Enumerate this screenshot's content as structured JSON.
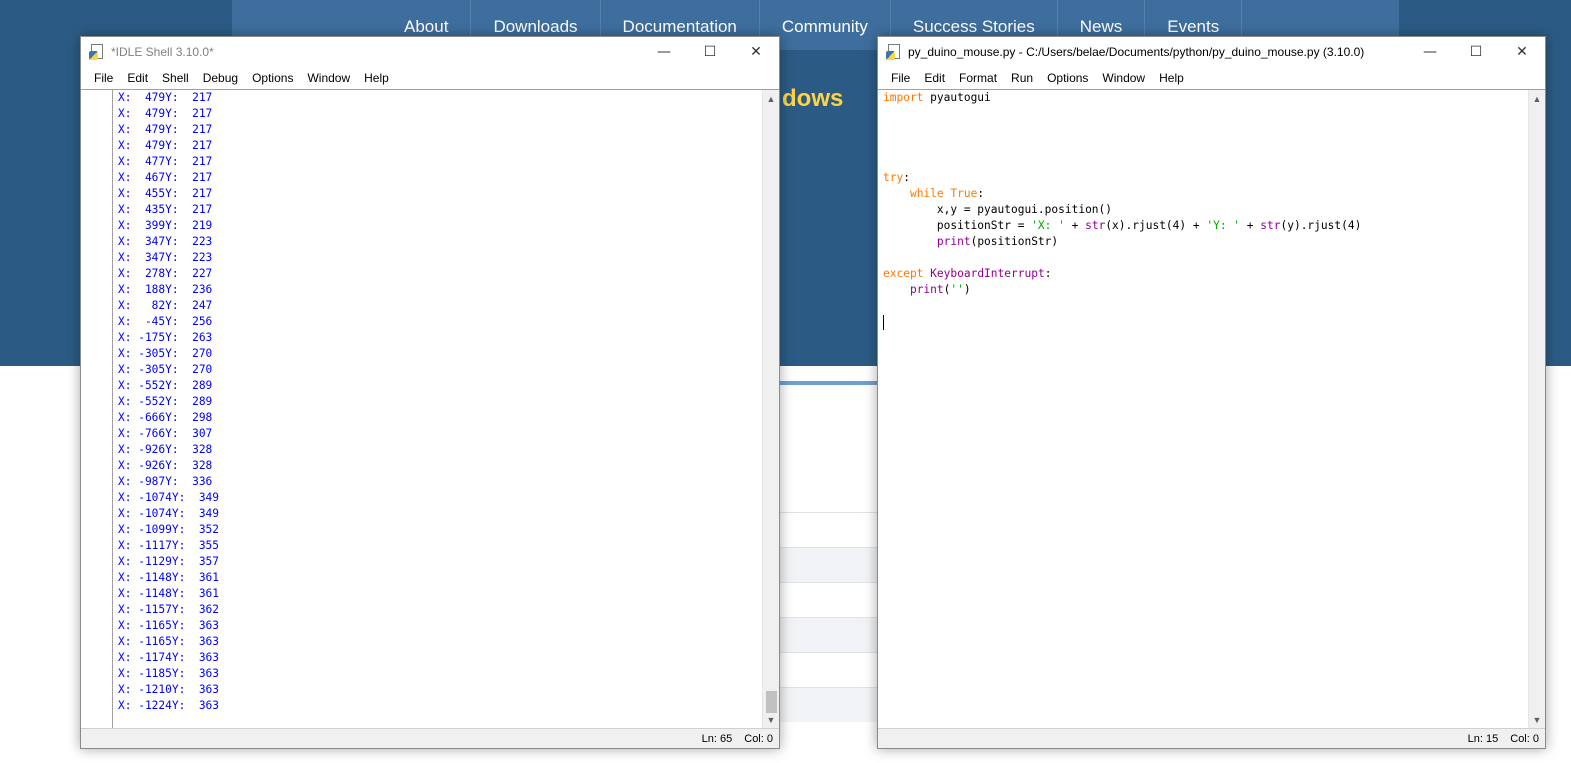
{
  "website": {
    "nav": [
      "About",
      "Downloads",
      "Documentation",
      "Community",
      "Success Stories",
      "News",
      "Events"
    ],
    "heading_fragment": "dows"
  },
  "shell_window": {
    "title": "*IDLE Shell 3.10.0*",
    "menu": [
      "File",
      "Edit",
      "Shell",
      "Debug",
      "Options",
      "Window",
      "Help"
    ],
    "output_lines": [
      "X:  479Y:  217",
      "X:  479Y:  217",
      "X:  479Y:  217",
      "X:  479Y:  217",
      "X:  477Y:  217",
      "X:  467Y:  217",
      "X:  455Y:  217",
      "X:  435Y:  217",
      "X:  399Y:  219",
      "X:  347Y:  223",
      "X:  347Y:  223",
      "X:  278Y:  227",
      "X:  188Y:  236",
      "X:   82Y:  247",
      "X:  -45Y:  256",
      "X: -175Y:  263",
      "X: -305Y:  270",
      "X: -305Y:  270",
      "X: -552Y:  289",
      "X: -552Y:  289",
      "X: -666Y:  298",
      "X: -766Y:  307",
      "X: -926Y:  328",
      "X: -926Y:  328",
      "X: -987Y:  336",
      "X: -1074Y:  349",
      "X: -1074Y:  349",
      "X: -1099Y:  352",
      "X: -1117Y:  355",
      "X: -1129Y:  357",
      "X: -1148Y:  361",
      "X: -1148Y:  361",
      "X: -1157Y:  362",
      "X: -1165Y:  363",
      "X: -1165Y:  363",
      "X: -1174Y:  363",
      "X: -1185Y:  363",
      "X: -1210Y:  363",
      "X: -1224Y:  363"
    ],
    "status": {
      "ln": "Ln: 65",
      "col": "Col: 0"
    }
  },
  "editor_window": {
    "title": "py_duino_mouse.py - C:/Users/belae/Documents/python/py_duino_mouse.py (3.10.0)",
    "menu": [
      "File",
      "Edit",
      "Format",
      "Run",
      "Options",
      "Window",
      "Help"
    ],
    "code_lines": [
      [
        {
          "t": "kw",
          "v": "import"
        },
        {
          "t": "",
          "v": " pyautogui"
        }
      ],
      [],
      [],
      [],
      [],
      [
        {
          "t": "kw",
          "v": "try"
        },
        {
          "t": "",
          "v": ":"
        }
      ],
      [
        {
          "t": "",
          "v": "    "
        },
        {
          "t": "kw",
          "v": "while"
        },
        {
          "t": "",
          "v": " "
        },
        {
          "t": "kw",
          "v": "True"
        },
        {
          "t": "",
          "v": ":"
        }
      ],
      [
        {
          "t": "",
          "v": "        x,y = pyautogui.position()"
        }
      ],
      [
        {
          "t": "",
          "v": "        positionStr = "
        },
        {
          "t": "st",
          "v": "'X: '"
        },
        {
          "t": "",
          "v": " + "
        },
        {
          "t": "bi",
          "v": "str"
        },
        {
          "t": "",
          "v": "(x).rjust(4) + "
        },
        {
          "t": "st",
          "v": "'Y: '"
        },
        {
          "t": "",
          "v": " + "
        },
        {
          "t": "bi",
          "v": "str"
        },
        {
          "t": "",
          "v": "(y).rjust(4)"
        }
      ],
      [
        {
          "t": "",
          "v": "        "
        },
        {
          "t": "bi",
          "v": "print"
        },
        {
          "t": "",
          "v": "(positionStr)"
        }
      ],
      [],
      [
        {
          "t": "kw",
          "v": "except"
        },
        {
          "t": "",
          "v": " "
        },
        {
          "t": "bi",
          "v": "KeyboardInterrupt"
        },
        {
          "t": "",
          "v": ":"
        }
      ],
      [
        {
          "t": "",
          "v": "    "
        },
        {
          "t": "bi",
          "v": "print"
        },
        {
          "t": "",
          "v": "("
        },
        {
          "t": "st",
          "v": "''"
        },
        {
          "t": "",
          "v": ")"
        }
      ],
      [],
      [
        {
          "t": "caret",
          "v": ""
        }
      ]
    ],
    "status": {
      "ln": "Ln: 15",
      "col": "Col: 0"
    }
  },
  "window_controls": {
    "minimize": "—",
    "maximize": "☐",
    "close": "✕"
  },
  "colors": {
    "site_header": "#2b5b84",
    "site_nav": "#3e6e9e",
    "site_accent": "#ffd343",
    "shell_output": "#0000ff",
    "keyword": "#ff7700",
    "builtin": "#900090",
    "string": "#00aa00"
  }
}
